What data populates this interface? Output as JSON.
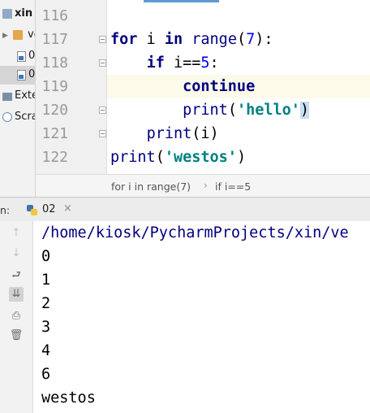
{
  "project_tree": {
    "items": [
      {
        "label": "xin",
        "icon": "folder-icon"
      },
      {
        "label": "ve",
        "icon": "folder-icon"
      },
      {
        "label": "0",
        "icon": "python-file-icon"
      },
      {
        "label": "0",
        "icon": "python-file-icon"
      },
      {
        "label": "Exte",
        "icon": "library-icon"
      },
      {
        "label": "Scra",
        "icon": "scratch-icon"
      }
    ]
  },
  "editor": {
    "line_numbers": [
      "116",
      "117",
      "118",
      "119",
      "120",
      "121",
      "122"
    ],
    "current_line": "119"
  },
  "breadcrumb": {
    "items": [
      "for i in range(7)",
      "if i==5"
    ],
    "separator": "›"
  },
  "run_panel": {
    "prefix": "n:",
    "tab_label": "02",
    "tab_close": "×"
  },
  "toolbar": {
    "icons": [
      "up-arrow-icon",
      "down-arrow-icon",
      "soft-wrap-icon",
      "scroll-to-end-icon",
      "print-icon",
      "trash-icon"
    ]
  },
  "console": {
    "lines": [
      "/home/kiosk/PycharmProjects/xin/ve",
      "0",
      "1",
      "2",
      "3",
      "4",
      "6",
      "westos"
    ]
  },
  "colors": {
    "keyword": "#000080",
    "number": "#0000ff",
    "string": "#008080",
    "gutter": "#f0f0f0",
    "current_line": "#fcfae9"
  }
}
